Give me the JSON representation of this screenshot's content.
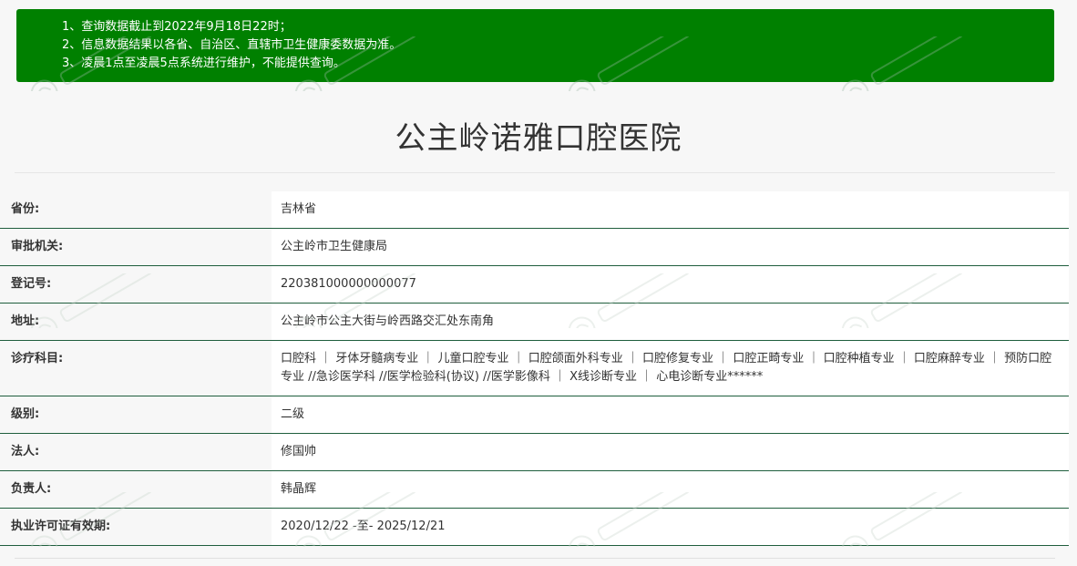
{
  "notice": {
    "lines": [
      "1、查询数据截止到2022年9月18日22时；",
      "2、信息数据结果以各省、自治区、直辖市卫生健康委数据为准。",
      "3、凌晨1点至凌晨5点系统进行维护，不能提供查询。"
    ]
  },
  "page_title": "公主岭诺雅口腔医院",
  "rows": [
    {
      "label": "省份:",
      "value": "吉林省"
    },
    {
      "label": "审批机关:",
      "value": "公主岭市卫生健康局"
    },
    {
      "label": "登记号:",
      "value": "220381000000000077"
    },
    {
      "label": "地址:",
      "value": "公主岭市公主大街与岭西路交汇处东南角"
    },
    {
      "label": "诊疗科目:",
      "value": "口腔科 ｜ 牙体牙髓病专业 ｜ 儿童口腔专业 ｜ 口腔颌面外科专业 ｜ 口腔修复专业 ｜ 口腔正畸专业 ｜ 口腔种植专业 ｜ 口腔麻醉专业 ｜ 预防口腔专业 //急诊医学科 //医学检验科(协议) //医学影像科 ｜ X线诊断专业 ｜ 心电诊断专业******"
    },
    {
      "label": "级别:",
      "value": "二级"
    },
    {
      "label": "法人:",
      "value": "修国帅"
    },
    {
      "label": "负责人:",
      "value": "韩晶辉"
    },
    {
      "label": "执业许可证有效期:",
      "value": "2020/12/22 -至- 2025/12/21"
    }
  ],
  "colors": {
    "notice_bg": "#008000",
    "row_border": "#1f5e3d"
  },
  "icons": [
    "watermark-logo-icon"
  ]
}
